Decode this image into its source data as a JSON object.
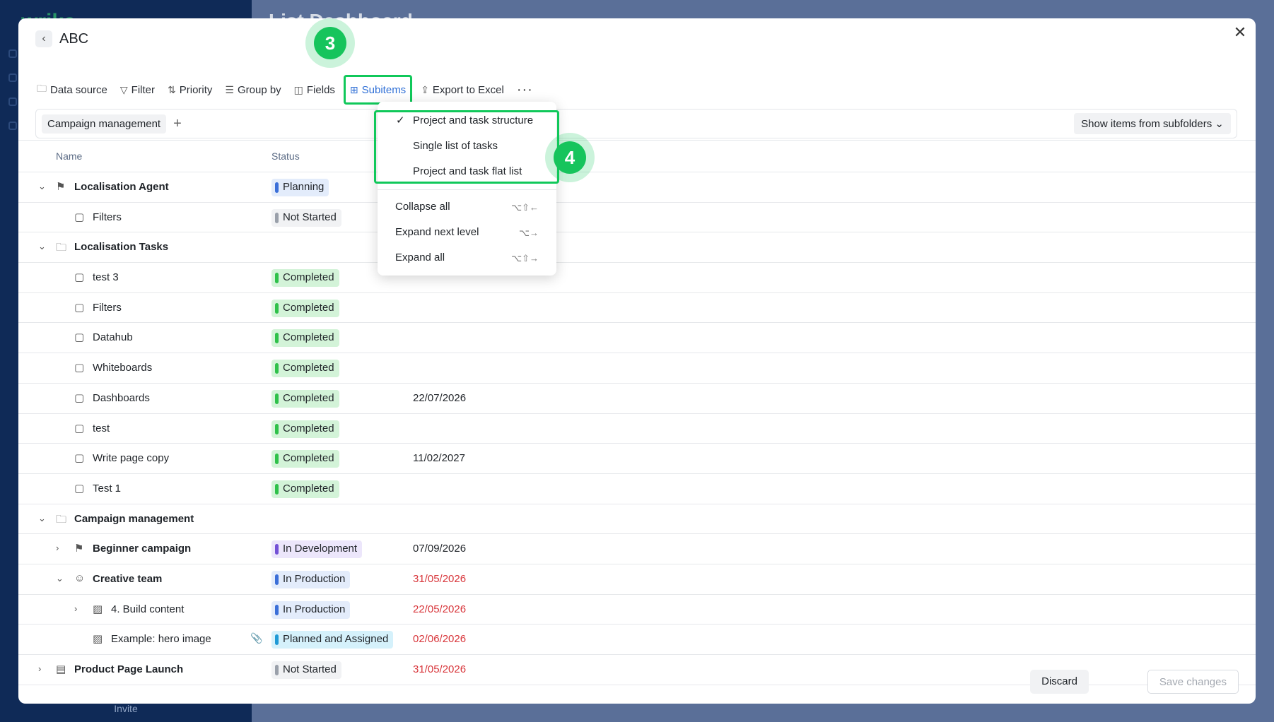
{
  "background": {
    "logo": "wrike",
    "title": "List Dashboard",
    "invite": "Invite"
  },
  "modal": {
    "title": "ABC",
    "toolbar": {
      "data_source": "Data source",
      "filter": "Filter",
      "priority": "Priority",
      "group_by": "Group by",
      "fields": "Fields",
      "subitems": "Subitems",
      "export": "Export to Excel"
    },
    "filter_chip": "Campaign management",
    "subfolders": "Show items from subfolders",
    "columns": {
      "name": "Name",
      "status": "Status"
    },
    "rows": [
      {
        "name": "Localisation Agent",
        "status": "Planning",
        "date": ""
      },
      {
        "name": "Filters",
        "status": "Not Started",
        "date": ""
      },
      {
        "name": "Localisation Tasks",
        "status": "",
        "date": ""
      },
      {
        "name": "test 3",
        "status": "Completed",
        "date": ""
      },
      {
        "name": "Filters",
        "status": "Completed",
        "date": ""
      },
      {
        "name": "Datahub",
        "status": "Completed",
        "date": ""
      },
      {
        "name": "Whiteboards",
        "status": "Completed",
        "date": ""
      },
      {
        "name": "Dashboards",
        "status": "Completed",
        "date": "22/07/2026"
      },
      {
        "name": "test",
        "status": "Completed",
        "date": ""
      },
      {
        "name": "Write page copy",
        "status": "Completed",
        "date": "11/02/2027"
      },
      {
        "name": "Test 1",
        "status": "Completed",
        "date": ""
      },
      {
        "name": "Campaign management",
        "status": "",
        "date": ""
      },
      {
        "name": "Beginner campaign",
        "status": "In Development",
        "date": "07/09/2026"
      },
      {
        "name": "Creative team",
        "status": "In Production",
        "date": "31/05/2026"
      },
      {
        "name": "4. Build content",
        "status": "In Production",
        "date": "22/05/2026"
      },
      {
        "name": "Example: hero image",
        "status": "Planned and Assigned",
        "date": "02/06/2026"
      },
      {
        "name": "Product Page Launch",
        "status": "Not Started",
        "date": "31/05/2026"
      }
    ],
    "dropdown": {
      "options": [
        "Project and task structure",
        "Single list of tasks",
        "Project and task flat list"
      ],
      "actions": [
        {
          "label": "Collapse all",
          "shortcut": "⌥⇧←"
        },
        {
          "label": "Expand next level",
          "shortcut": "⌥→"
        },
        {
          "label": "Expand all",
          "shortcut": "⌥⇧→"
        }
      ]
    },
    "steps": [
      "3",
      "4"
    ],
    "footer": {
      "discard": "Discard",
      "save": "Save changes"
    }
  },
  "colors": {
    "accent": "#2f6fd6",
    "highlight": "#10c85a",
    "overdue": "#d8363b",
    "completed_bg": "#d3f3d8",
    "completed_bar": "#2fc14a",
    "planning_bg": "#e3ecfb",
    "planning_bar": "#3b6fd8",
    "notstarted_bg": "#f1f2f4",
    "notstarted_bar": "#9aa0aa",
    "development_bg": "#ece6fb",
    "development_bar": "#7451d6",
    "production_bg": "#e3ecfb",
    "production_bar": "#3b6fd8",
    "planned_bg": "#d5f1fb",
    "planned_bar": "#1f9ad6"
  }
}
